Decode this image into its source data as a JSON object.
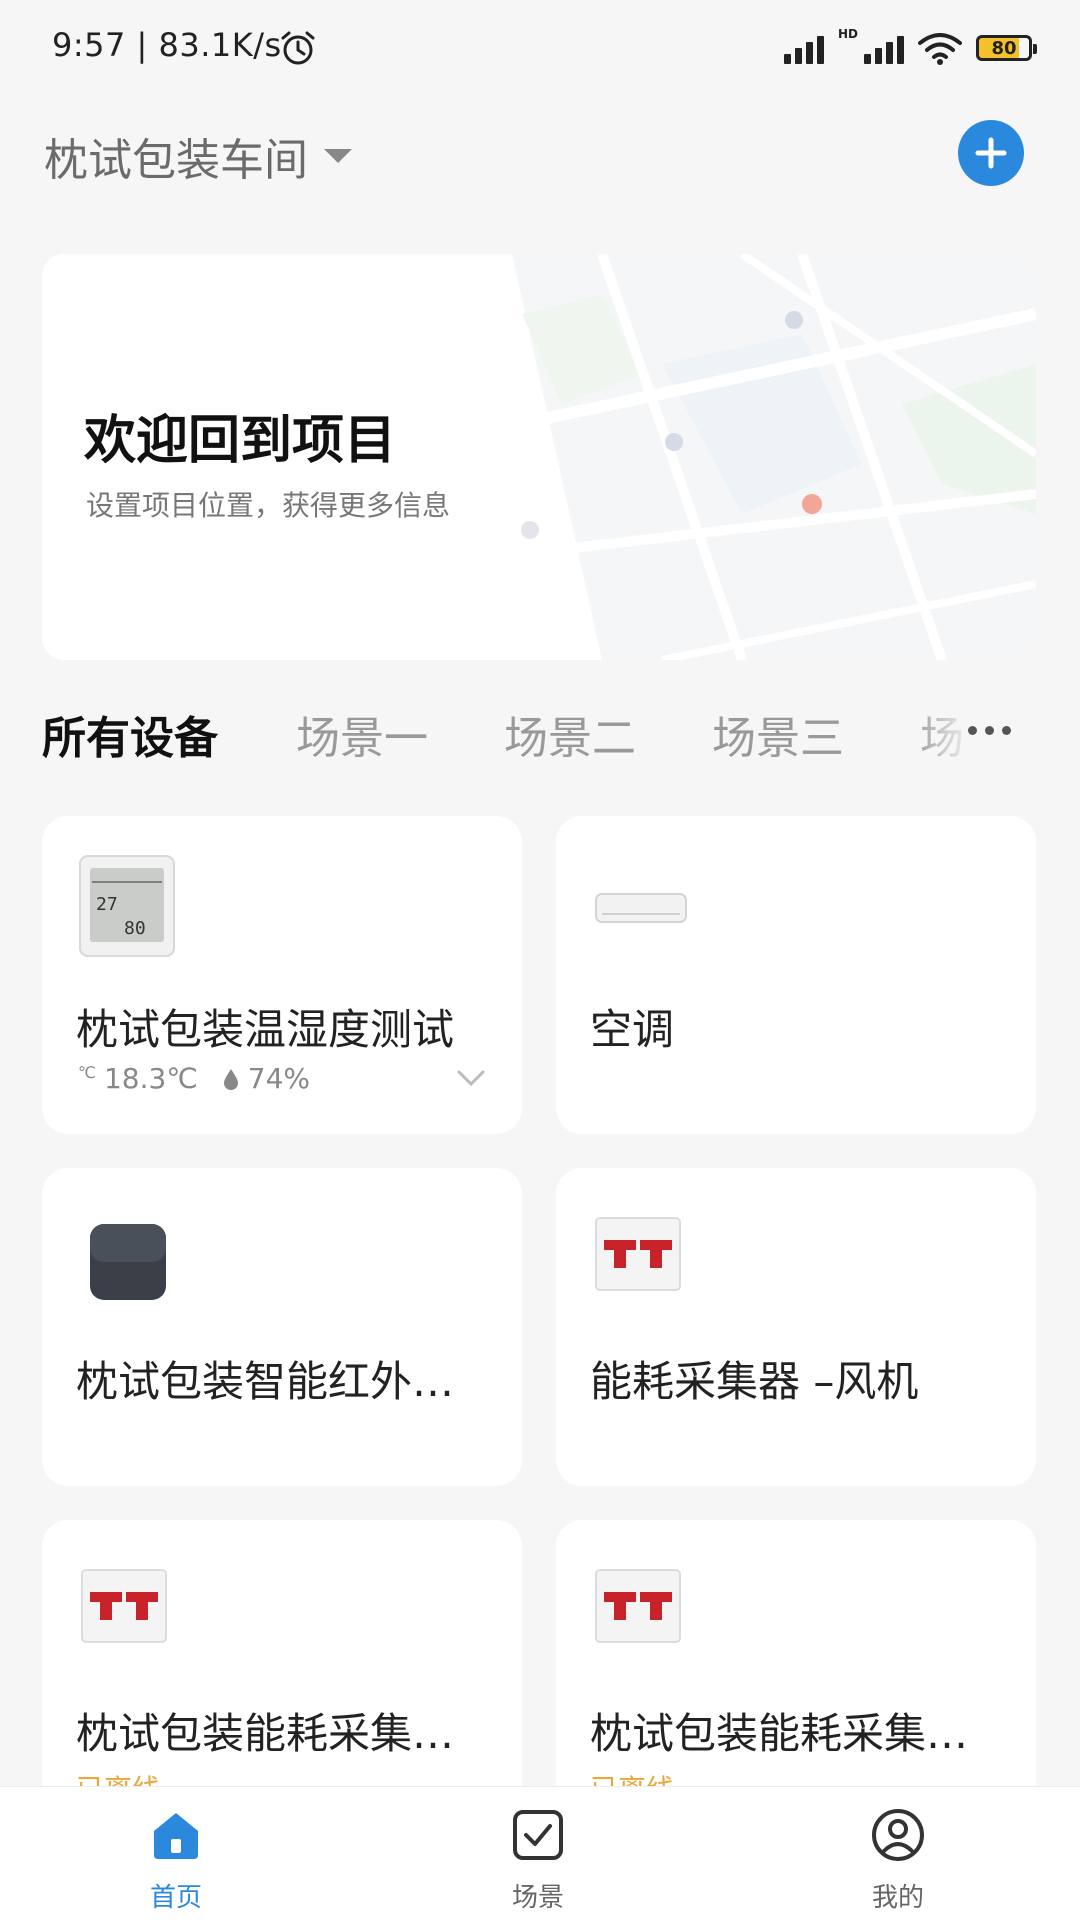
{
  "status_bar": {
    "time": "9:57 | 83.1K/s",
    "hd": "HD",
    "battery": "80",
    "icons": [
      "alarm-icon",
      "signal-icon",
      "wifi-icon",
      "battery-icon"
    ]
  },
  "header": {
    "project_name": "枕试包装车间",
    "add_icon": "plus-icon",
    "accent": "#2a89dd"
  },
  "welcome": {
    "title": "欢迎回到项目",
    "subtitle": "设置项目位置，获得更多信息"
  },
  "tabs": [
    {
      "label": "所有设备",
      "active": true
    },
    {
      "label": "场景一",
      "active": false
    },
    {
      "label": "场景二",
      "active": false
    },
    {
      "label": "场景三",
      "active": false
    },
    {
      "label": "场",
      "active": false
    }
  ],
  "devices": [
    {
      "name": "枕试包装温湿度测试",
      "icon": "thermo-hygrometer",
      "temperature": "18.3℃",
      "humidity": "74%",
      "temp_prefix": "℃"
    },
    {
      "name": "空调",
      "icon": "air-conditioner"
    },
    {
      "name": "枕试包装智能红外…",
      "icon": "ir-remote-hub"
    },
    {
      "name": "能耗采集器 –风机",
      "icon": "energy-meter"
    },
    {
      "name": "枕试包装能耗采集…",
      "icon": "energy-meter",
      "status": "已离线"
    },
    {
      "name": "枕试包装能耗采集…",
      "icon": "energy-meter",
      "status": "已离线"
    }
  ],
  "bottom_nav": [
    {
      "label": "首页",
      "icon": "home-icon",
      "active": true
    },
    {
      "label": "场景",
      "icon": "scene-check-icon",
      "active": false
    },
    {
      "label": "我的",
      "icon": "profile-icon",
      "active": false
    }
  ],
  "colors": {
    "offline": "#e9a63a",
    "active_tab": "#111111",
    "inactive_tab": "#999999"
  }
}
